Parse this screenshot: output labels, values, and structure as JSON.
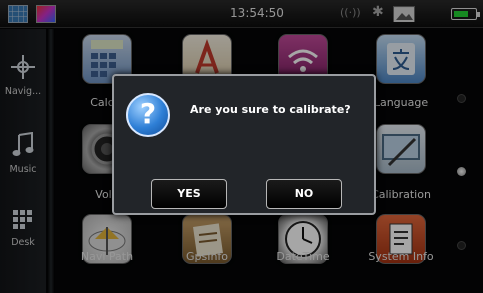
{
  "statusbar": {
    "time": "13:54:50",
    "icons": [
      "grid-app-icon",
      "color-palette-icon",
      "signal-icon",
      "bluetooth-icon",
      "photo-icon",
      "battery-icon"
    ],
    "battery_color": "#22d333"
  },
  "leftnav": {
    "items": [
      {
        "label": "Navig...",
        "icon": "compass-icon"
      },
      {
        "label": "Music",
        "icon": "music-note-icon"
      },
      {
        "label": "Desk",
        "icon": "desk-grid-icon"
      }
    ]
  },
  "apps": {
    "row1": [
      {
        "label": "Calcul",
        "icon": "calculator-icon"
      },
      {
        "label": "",
        "icon": "appstore-icon"
      },
      {
        "label": "",
        "icon": "wifi-icon"
      },
      {
        "label": "Language",
        "icon": "language-icon"
      }
    ],
    "row2": [
      {
        "label": "Volu",
        "icon": "volume-icon"
      },
      {
        "label": "",
        "icon": "hidden-icon"
      },
      {
        "label": "",
        "icon": "hidden-icon"
      },
      {
        "label": "Calibration",
        "icon": "calibration-icon"
      }
    ],
    "row3": [
      {
        "label": "Navi Path",
        "icon": "navi-path-icon"
      },
      {
        "label": "GpsInfo",
        "icon": "gpsinfo-icon"
      },
      {
        "label": "DateTime",
        "icon": "clock-icon"
      },
      {
        "label": "System Info",
        "icon": "system-info-icon"
      }
    ]
  },
  "dialog": {
    "message": "Are you sure to calibrate?",
    "icon": "question-icon",
    "yes_label": "YES",
    "no_label": "NO"
  },
  "colors": {
    "accent_blue": "#2e7fd6",
    "background": "#050607",
    "dialog_bg": "#222529"
  }
}
